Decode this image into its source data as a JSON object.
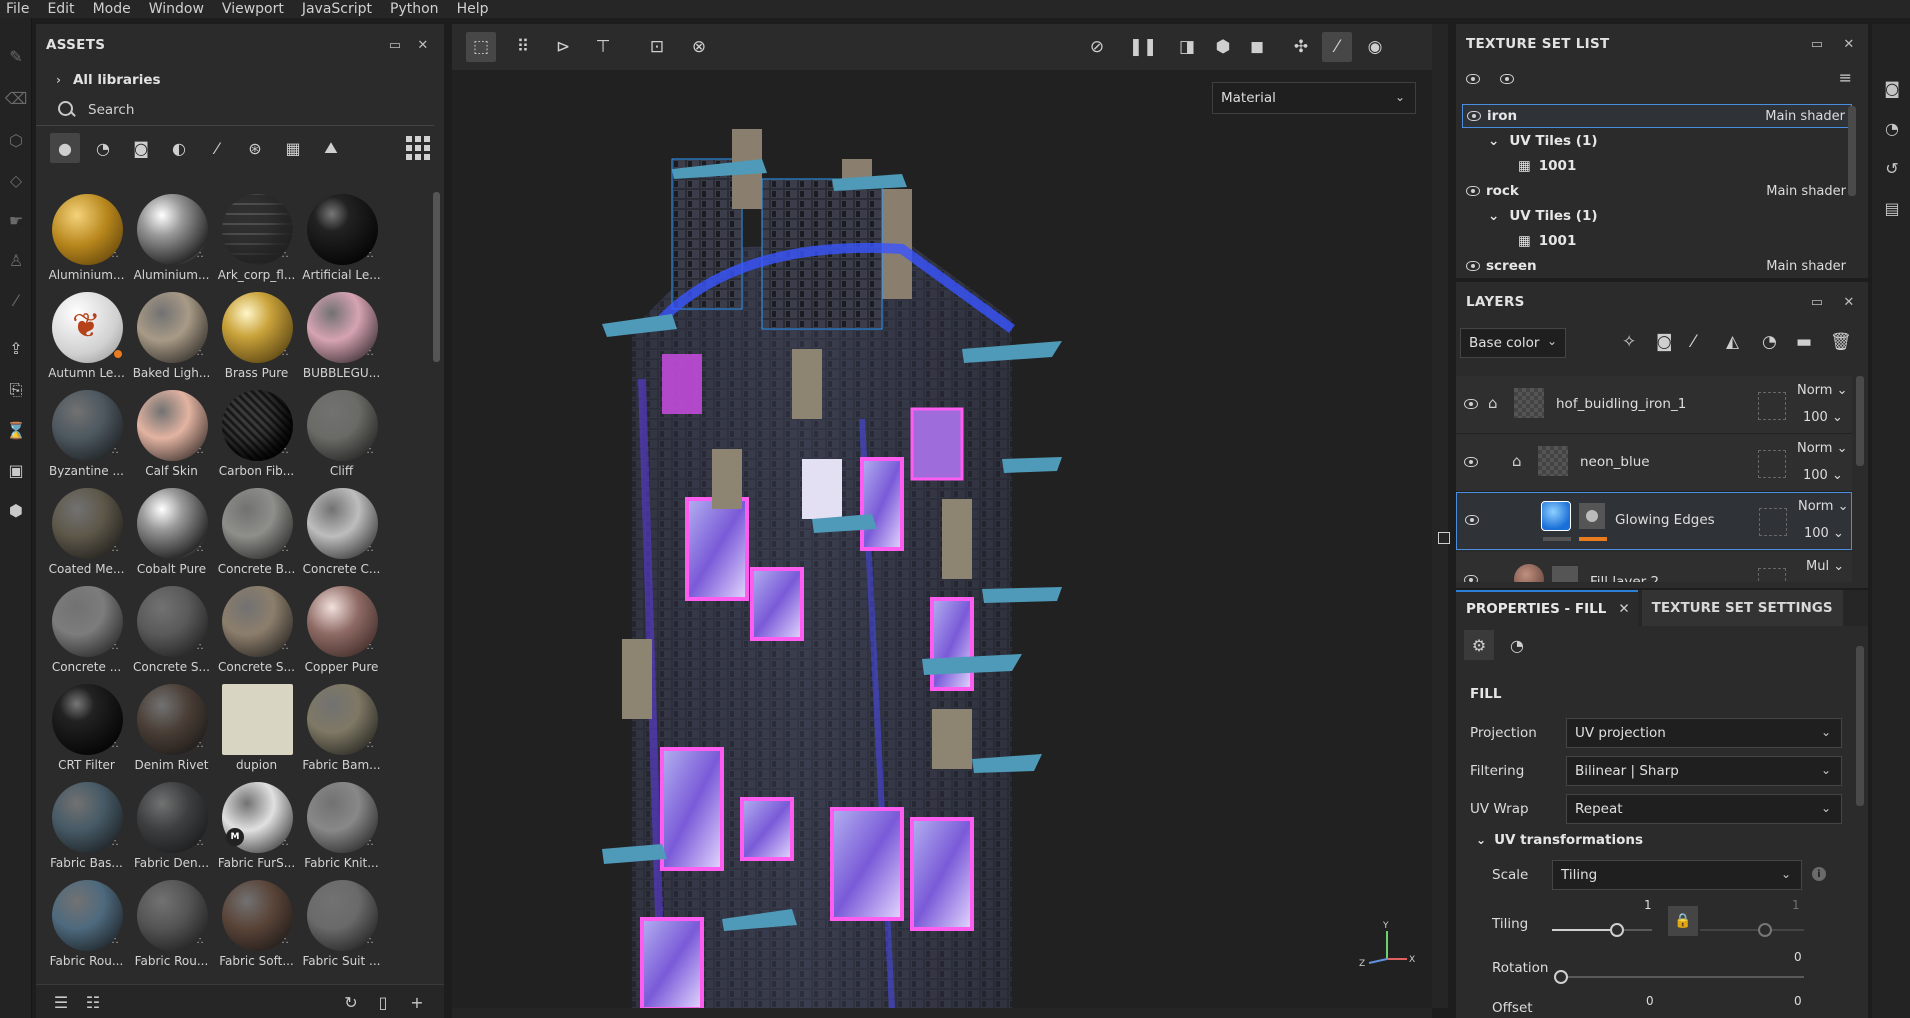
{
  "menu": [
    "File",
    "Edit",
    "Mode",
    "Window",
    "Viewport",
    "JavaScript",
    "Python",
    "Help"
  ],
  "assets": {
    "title": "ASSETS",
    "library": "All libraries",
    "search_placeholder": "Search",
    "items": [
      {
        "label": "Aluminium...",
        "color": "#c8942a",
        "style": "gold-dot"
      },
      {
        "label": "Aluminium...",
        "color": "#9a9a9a",
        "style": "chrome"
      },
      {
        "label": "Ark_corp_fl...",
        "color": "#8a8a8a",
        "style": "grid"
      },
      {
        "label": "Artificial Le...",
        "color": "#1c1c1c",
        "style": "dark"
      },
      {
        "label": "Autumn Le...",
        "color": "#d8d8d8",
        "style": "leaf"
      },
      {
        "label": "Baked Ligh...",
        "color": "#a89a86",
        "style": "plain"
      },
      {
        "label": "Brass Pure",
        "color": "#c0a040",
        "style": "brass"
      },
      {
        "label": "BUBBLEGU...",
        "color": "#d6a3b3",
        "style": "plain"
      },
      {
        "label": "Byzantine ...",
        "color": "#4d5860",
        "style": "tile"
      },
      {
        "label": "Calf Skin",
        "color": "#e2b3a1",
        "style": "plain"
      },
      {
        "label": "Carbon Fib...",
        "color": "#2a2a2a",
        "style": "carbon"
      },
      {
        "label": "Cliff",
        "color": "#6a6a66",
        "style": "rock"
      },
      {
        "label": "Coated Me...",
        "color": "#5e584a",
        "style": "plain"
      },
      {
        "label": "Cobalt Pure",
        "color": "#9b9b9b",
        "style": "chrome"
      },
      {
        "label": "Concrete B...",
        "color": "#8e8e8a",
        "style": "rock"
      },
      {
        "label": "Concrete C...",
        "color": "#bdbdbd",
        "style": "plain"
      },
      {
        "label": "Concrete ...",
        "color": "#7c7c7c",
        "style": "plain"
      },
      {
        "label": "Concrete S...",
        "color": "#5a5a5a",
        "style": "plain"
      },
      {
        "label": "Concrete S...",
        "color": "#8c7e6c",
        "style": "plain"
      },
      {
        "label": "Copper Pure",
        "color": "#9a7a74",
        "style": "copper"
      },
      {
        "label": "CRT Filter",
        "color": "#111111",
        "style": "dark"
      },
      {
        "label": "Denim Rivet",
        "color": "#4a3e36",
        "style": "rivet"
      },
      {
        "label": "dupion",
        "color": "#d8d6c2",
        "style": "square"
      },
      {
        "label": "Fabric Bam...",
        "color": "#7e7864",
        "style": "plain"
      },
      {
        "label": "Fabric Bas...",
        "color": "#465a66",
        "style": "plain"
      },
      {
        "label": "Fabric Den...",
        "color": "#3c3e40",
        "style": "plain"
      },
      {
        "label": "Fabric FurS...",
        "color": "#e0e0e0",
        "style": "fur"
      },
      {
        "label": "Fabric Knit...",
        "color": "#888888",
        "style": "plain"
      },
      {
        "label": "Fabric Rou...",
        "color": "#4e6a7e",
        "style": "plain"
      },
      {
        "label": "Fabric Rou...",
        "color": "#555555",
        "style": "plain"
      },
      {
        "label": "Fabric Soft...",
        "color": "#5a4438",
        "style": "plain"
      },
      {
        "label": "Fabric Suit ...",
        "color": "#6a6a6a",
        "style": "suit"
      }
    ]
  },
  "viewport": {
    "material_mode": "Material"
  },
  "texture_set_list": {
    "title": "TEXTURE SET LIST",
    "rows": [
      {
        "name": "iron",
        "shader": "Main shader",
        "kind": "set"
      },
      {
        "name": "UV Tiles (1)",
        "kind": "tiles"
      },
      {
        "name": "1001",
        "kind": "tile"
      },
      {
        "name": "rock",
        "shader": "Main shader",
        "kind": "set"
      },
      {
        "name": "UV Tiles (1)",
        "kind": "tiles"
      },
      {
        "name": "1001",
        "kind": "tile"
      },
      {
        "name": "screen",
        "shader": "Main shader",
        "kind": "set"
      }
    ]
  },
  "layers": {
    "title": "LAYERS",
    "channel": "Base color",
    "items": [
      {
        "name": "hof_buidling_iron_1",
        "blend": "Norm",
        "opacity": "100"
      },
      {
        "name": "neon_blue",
        "blend": "Norm",
        "opacity": "100"
      },
      {
        "name": "Glowing Edges",
        "blend": "Norm",
        "opacity": "100"
      },
      {
        "name": "Fill layer 2",
        "blend": "Mul",
        "opacity": ""
      }
    ]
  },
  "properties": {
    "tab_fill": "PROPERTIES - FILL",
    "tab_settings": "TEXTURE SET SETTINGS",
    "section": "FILL",
    "projection_label": "Projection",
    "projection": "UV projection",
    "filtering_label": "Filtering",
    "filtering": "Bilinear | Sharp",
    "uvwrap_label": "UV Wrap",
    "uvwrap": "Repeat",
    "uvtrans_label": "UV transformations",
    "scale_label": "Scale",
    "scale": "Tiling",
    "tiling_label": "Tiling",
    "tiling_value": "1",
    "tiling_value2": "1",
    "rotation_label": "Rotation",
    "rotation_value": "0",
    "offset_label": "Offset",
    "offset_x": "0",
    "offset_y": "0"
  }
}
